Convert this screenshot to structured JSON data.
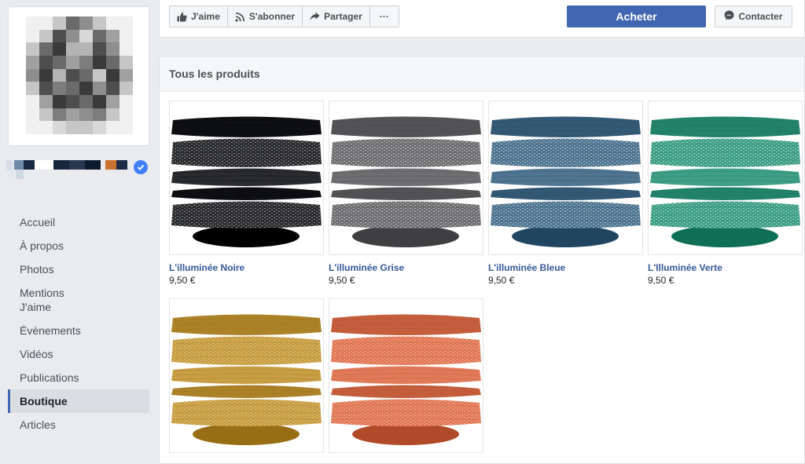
{
  "sidebar": {
    "nav": [
      {
        "label": "Accueil",
        "active": false
      },
      {
        "label": "À propos",
        "active": false
      },
      {
        "label": "Photos",
        "active": false
      },
      {
        "label": "Mentions J'aime",
        "active": false
      },
      {
        "label": "Évènements",
        "active": false
      },
      {
        "label": "Vidéos",
        "active": false
      },
      {
        "label": "Publications",
        "active": false
      },
      {
        "label": "Boutique",
        "active": true
      },
      {
        "label": "Articles",
        "active": false
      }
    ]
  },
  "actions": {
    "like_label": "J'aime",
    "subscribe_label": "S'abonner",
    "share_label": "Partager",
    "more_label": "···",
    "buy_label": "Acheter",
    "contact_label": "Contacter"
  },
  "shop": {
    "section_title": "Tous les produits",
    "products": [
      {
        "name": "L'illuminée Noire",
        "price": "9,50 €",
        "color": "#2a2b2e",
        "speckle": "#8c8c8c"
      },
      {
        "name": "L'illuminée Grise",
        "price": "9,50 €",
        "color": "#6f6f72",
        "speckle": "#b9b9bb"
      },
      {
        "name": "L'illuminée Bleue",
        "price": "9,50 €",
        "color": "#4f7590",
        "speckle": "#a9bccb"
      },
      {
        "name": "L'Illuminée Verte",
        "price": "9,50 €",
        "color": "#3e9e86",
        "speckle": "#9fd3c3"
      },
      {
        "name": "",
        "price": "",
        "color": "#c89e45",
        "speckle": "#dcbd78"
      },
      {
        "name": "",
        "price": "",
        "color": "#e07a58",
        "speckle": "#f0a587"
      }
    ]
  },
  "colors": {
    "brand_blue": "#4267b2",
    "link_blue": "#365899",
    "page_bg": "#e9ebee"
  }
}
